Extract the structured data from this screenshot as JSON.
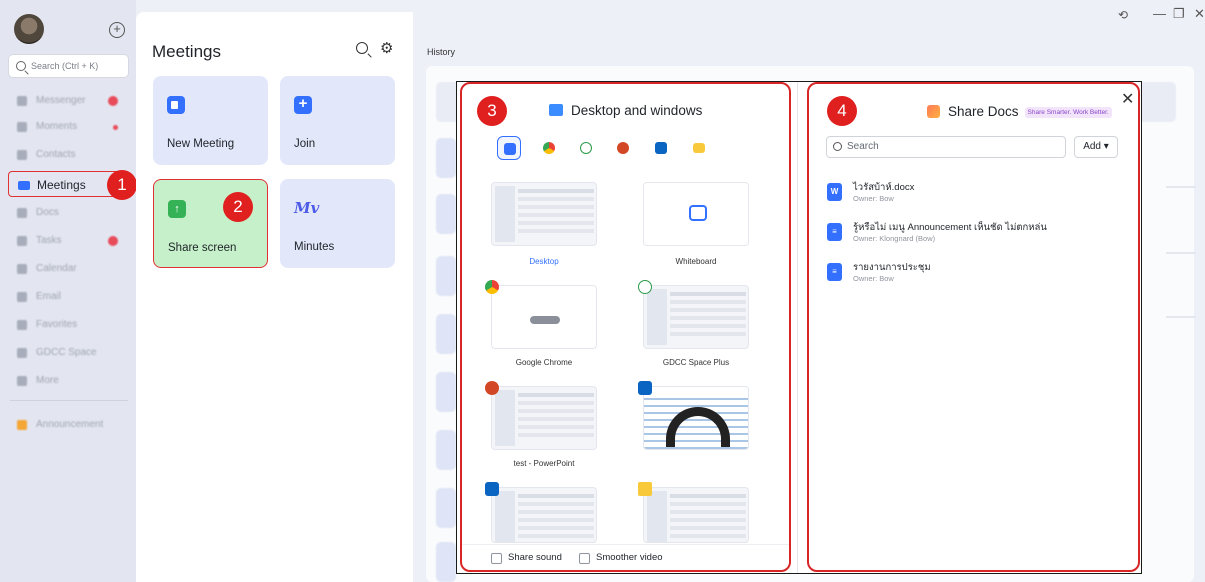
{
  "nav": {
    "search_placeholder": "Search (Ctrl + K)",
    "items": [
      {
        "label": "Messenger"
      },
      {
        "label": "Moments"
      },
      {
        "label": "Contacts"
      },
      {
        "label": "Meetings"
      },
      {
        "label": "Docs"
      },
      {
        "label": "Tasks"
      },
      {
        "label": "Calendar"
      },
      {
        "label": "Email"
      },
      {
        "label": "Favorites"
      },
      {
        "label": "GDCC Space"
      },
      {
        "label": "More"
      },
      {
        "label": "Announcement"
      }
    ]
  },
  "steps": [
    "1",
    "2",
    "3",
    "4"
  ],
  "meetings": {
    "title": "Meetings",
    "cards": [
      {
        "label": "New Meeting"
      },
      {
        "label": "Join"
      },
      {
        "label": "Share screen"
      },
      {
        "label": "Minutes"
      }
    ]
  },
  "history": {
    "title": "History"
  },
  "share_dialog": {
    "desktop_title": "Desktop and windows",
    "thumbnails": [
      {
        "label": "Desktop"
      },
      {
        "label": "Whiteboard"
      },
      {
        "label": "Google Chrome"
      },
      {
        "label": "GDCC Space Plus"
      },
      {
        "label": "test - PowerPoint"
      }
    ],
    "share_sound": "Share sound",
    "smoother_video": "Smoother video",
    "docs_title": "Share Docs",
    "docs_tagline": "Share Smarter. Work Better.",
    "search_placeholder": "Search",
    "add_label": "Add",
    "docs": [
      {
        "icon": "W",
        "title": "ไวรัสบ้าห์.docx",
        "owner": "Owner: Bow"
      },
      {
        "icon": "≡",
        "title": "รู้หรือไม่ เมนู Announcement เห็นชัด ไม่ตกหล่น",
        "owner": "Owner: Klongnard (Bow)"
      },
      {
        "icon": "≡",
        "title": "รายงานการประชุม",
        "owner": "Owner: Bow"
      }
    ]
  },
  "colors": {
    "accent": "#3370ff",
    "highlight_frame": "#e03232",
    "share_card": "#c6f0c9"
  }
}
